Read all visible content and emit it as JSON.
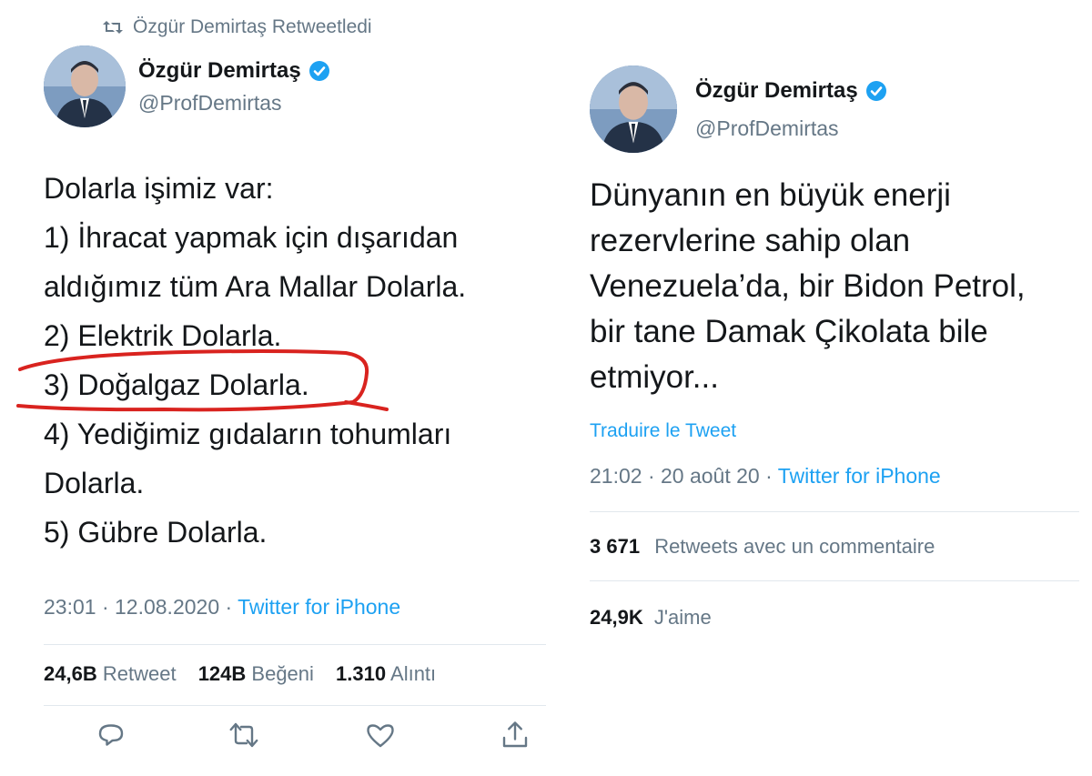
{
  "left": {
    "retweet_text": "Özgür Demirtaş Retweetledi",
    "name": "Özgür Demirtaş",
    "handle": "@ProfDemirtas",
    "lines": [
      "Dolarla işimiz var:",
      "1) İhracat yapmak için dışarıdan",
      "aldığımız tüm Ara Mallar Dolarla.",
      "2) Elektrik Dolarla.",
      "3) Doğalgaz Dolarla.",
      "4) Yediğimiz gıdaların tohumları",
      "Dolarla.",
      "5) Gübre Dolarla."
    ],
    "time": "23:01 · 12.08.2020 · ",
    "source": "Twitter for iPhone",
    "stats": {
      "retweets_count": "24,6B",
      "retweets_label": "Retweet",
      "likes_count": "124B",
      "likes_label": "Beğeni",
      "quotes_count": "1.310",
      "quotes_label": "Alıntı"
    },
    "actions": [
      "reply-icon",
      "retweet-icon",
      "like-icon",
      "share-icon"
    ],
    "highlight_color": "#d9231f"
  },
  "right": {
    "name": "Özgür Demirtaş",
    "handle": "@ProfDemirtas",
    "text_lines": [
      "Dünyanın en büyük enerji",
      "rezervlerine sahip olan",
      "Venezuela’da, bir Bidon Petrol,",
      "bir tane Damak Çikolata bile",
      "etmiyor..."
    ],
    "translate": "Traduire le Tweet",
    "time": "21:02 · 20 août 20 · ",
    "source": "Twitter for iPhone",
    "quote_count": "3 671",
    "quote_label": "Retweets avec un commentaire",
    "like_count": "24,9K",
    "like_label": "J'aime"
  },
  "colors": {
    "link": "#1da1f2",
    "muted": "#657786",
    "verified": "#1da1f2"
  }
}
